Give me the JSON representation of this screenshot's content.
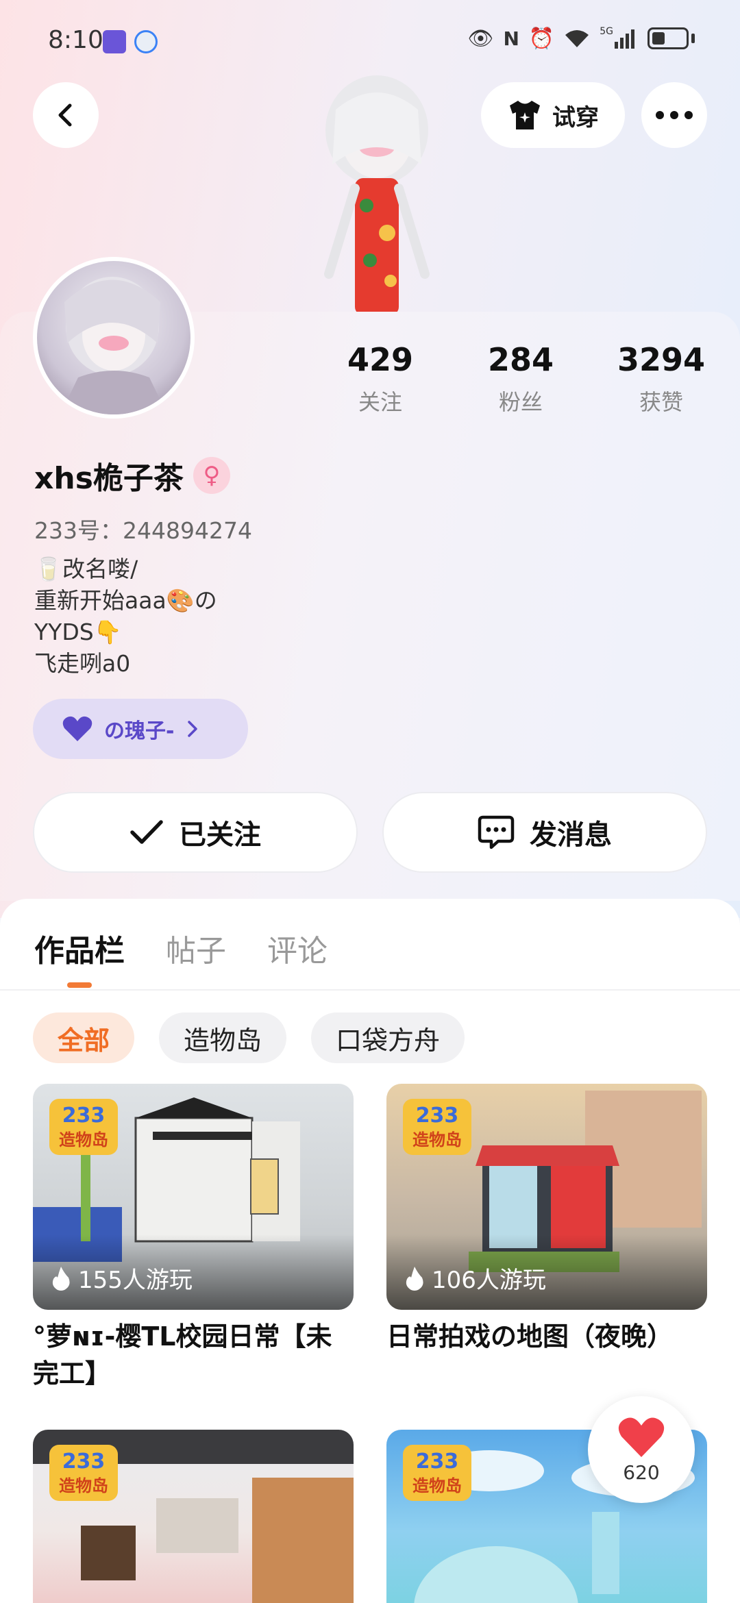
{
  "status_bar": {
    "time": "8:10",
    "network": "5G"
  },
  "header": {
    "try_on_label": "试穿"
  },
  "profile": {
    "stats": [
      {
        "value": "429",
        "label": "关注"
      },
      {
        "value": "284",
        "label": "粉丝"
      },
      {
        "value": "3294",
        "label": "获赞"
      }
    ],
    "username": "xhs桅子茶",
    "account_id": "233号：244894274",
    "bio_lines": [
      "🥛改名喽/",
      "重新开始aaa🎨の",
      "YYDS👇",
      "飞走咧a0"
    ],
    "group_label": "の瑰子-",
    "follow_label": "已关注",
    "message_label": "发消息"
  },
  "tabs": [
    "作品栏",
    "帖子",
    "评论"
  ],
  "chips": [
    "全部",
    "造物岛",
    "口袋方舟"
  ],
  "works": [
    {
      "plays": "155人游玩",
      "title": "°萝ɴɪ-樱TL校园日常【未完工】",
      "badge": "233造物岛"
    },
    {
      "plays": "106人游玩",
      "title": "日常拍戏の地图（夜晚）",
      "badge": "233造物岛"
    },
    {
      "plays": "",
      "title": "",
      "badge": "233造物岛"
    },
    {
      "plays": "",
      "title": "",
      "badge": "233造物岛"
    }
  ],
  "like_fab": {
    "count": "620"
  },
  "colors": {
    "accent": "#f06d24",
    "group_pill": "#e2dcf5",
    "group_text": "#5a48c8",
    "like": "#f0404a"
  }
}
